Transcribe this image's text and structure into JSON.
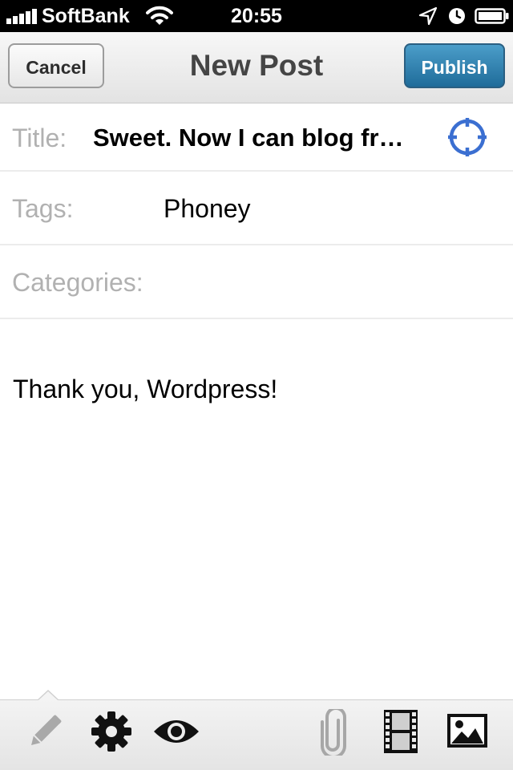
{
  "status_bar": {
    "carrier": "SoftBank",
    "time": "20:55",
    "icons": [
      "signal-icon",
      "wifi-icon",
      "location-arrow-icon",
      "alarm-clock-icon",
      "battery-icon"
    ]
  },
  "nav": {
    "cancel_label": "Cancel",
    "title": "New Post",
    "publish_label": "Publish"
  },
  "form": {
    "title_label": "Title:",
    "title_value": "Sweet.  Now I can blog fr…",
    "tags_label": "Tags:",
    "tags_value": "Phoney",
    "categories_label": "Categories:",
    "categories_value": ""
  },
  "body": {
    "content": "Thank you, Wordpress!"
  },
  "toolbar": {
    "icons": [
      "pencil-icon",
      "gear-icon",
      "eye-icon",
      "paperclip-icon",
      "film-icon",
      "image-icon"
    ]
  },
  "colors": {
    "publish_button": "#2b7bab",
    "location_icon": "#3b6fd1",
    "label_gray": "#b1b1b1"
  }
}
